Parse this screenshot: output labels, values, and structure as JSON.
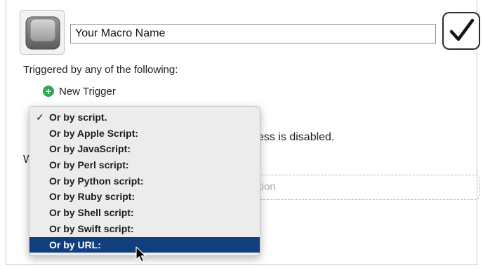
{
  "macro": {
    "name_value": "Your Macro Name",
    "icon": "keyboard-key-icon",
    "enabled_icon": "checkmark-icon"
  },
  "triggers": {
    "heading": "Triggered by any of the following:",
    "new_trigger_label": "New Trigger",
    "new_trigger_icon": "plus-circle-icon"
  },
  "background": {
    "partial_status": "cess is disabled.",
    "partial_section_letter": "W",
    "partial_action_placeholder": "ction"
  },
  "menu": {
    "check_glyph": "✓",
    "items": [
      {
        "label": "Or by script.",
        "checked": true
      },
      {
        "label": "Or by Apple Script:"
      },
      {
        "label": "Or by JavaScript:"
      },
      {
        "label": "Or by Perl script:"
      },
      {
        "label": "Or by Python script:"
      },
      {
        "label": "Or by Ruby script:"
      },
      {
        "label": "Or by Shell script:"
      },
      {
        "label": "Or by Swift script:"
      },
      {
        "label": "Or by URL:",
        "highlighted": true
      }
    ]
  },
  "colors": {
    "highlight": "#113f7d",
    "plus_green": "#2fa84f"
  }
}
